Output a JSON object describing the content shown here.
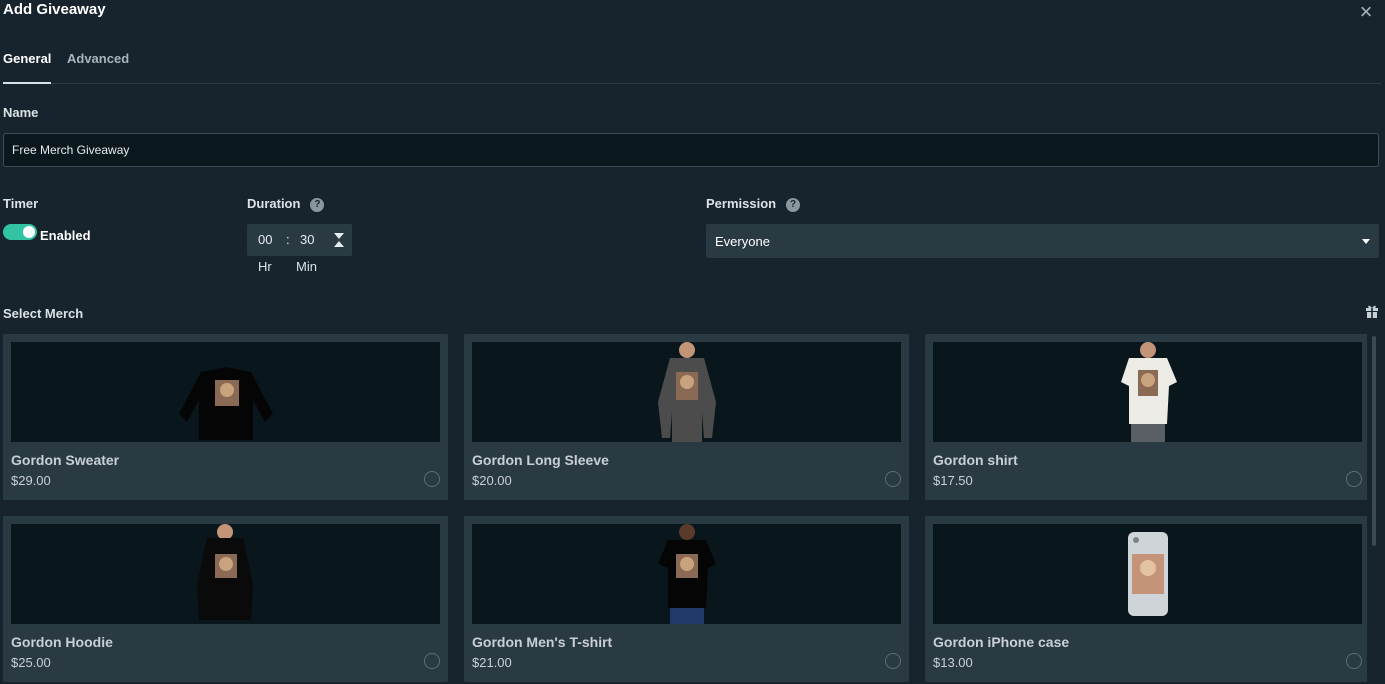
{
  "dialog": {
    "title": "Add Giveaway"
  },
  "tabs": [
    {
      "label": "General"
    },
    {
      "label": "Advanced"
    }
  ],
  "name": {
    "label": "Name",
    "value": "Free Merch Giveaway"
  },
  "timer": {
    "label": "Timer",
    "toggle_label": "Enabled",
    "enabled": true
  },
  "duration": {
    "label": "Duration",
    "hours": "00",
    "separator": ":",
    "minutes": "30",
    "hr_label": "Hr",
    "min_label": "Min"
  },
  "permission": {
    "label": "Permission",
    "value": "Everyone"
  },
  "merch": {
    "label": "Select Merch",
    "items": [
      {
        "name": "Gordon Sweater",
        "price": "$29.00",
        "image": "sweater"
      },
      {
        "name": "Gordon Long Sleeve",
        "price": "$20.00",
        "image": "long-sleeve"
      },
      {
        "name": "Gordon shirt",
        "price": "$17.50",
        "image": "shirt"
      },
      {
        "name": "Gordon Hoodie",
        "price": "$25.00",
        "image": "hoodie"
      },
      {
        "name": "Gordon Men's T-shirt",
        "price": "$21.00",
        "image": "mens-tshirt"
      },
      {
        "name": "Gordon iPhone case",
        "price": "$13.00",
        "image": "iphone-case"
      }
    ]
  },
  "colors": {
    "background": "#17242d",
    "accent": "#31c3a2",
    "card": "#2a3a43"
  }
}
